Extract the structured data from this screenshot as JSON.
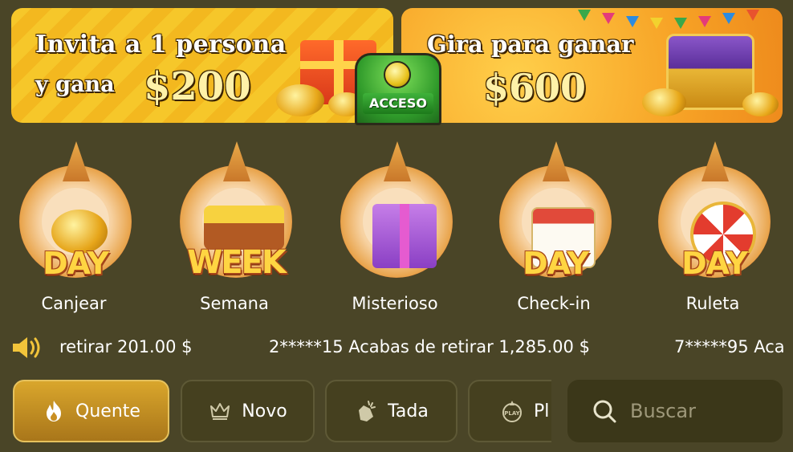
{
  "banners": {
    "invite": {
      "line1": "Invita a 1 persona",
      "line2": "y gana",
      "amount": "$200"
    },
    "spin": {
      "line1": "Gira para ganar",
      "amount": "$600"
    }
  },
  "badge": {
    "label": "ACCESO"
  },
  "activities": [
    {
      "label": "Canjear",
      "word": "DAY",
      "icon": "piggy-bank-icon"
    },
    {
      "label": "Semana",
      "word": "WEEK",
      "icon": "treasure-cart-icon"
    },
    {
      "label": "Misterioso",
      "word": "",
      "icon": "mystery-gift-icon"
    },
    {
      "label": "Check-in",
      "word": "DAY",
      "icon": "calendar-icon"
    },
    {
      "label": "Ruleta",
      "word": "DAY",
      "icon": "roulette-wheel-icon"
    }
  ],
  "marquee": {
    "items": [
      "retirar 201.00 $",
      "2*****15 Acabas de retirar 1,285.00 $",
      "7*****95 Aca"
    ]
  },
  "tabs": [
    {
      "label": "Quente",
      "icon": "flame-icon",
      "active": true
    },
    {
      "label": "Novo",
      "icon": "crown-icon",
      "active": false
    },
    {
      "label": "Tada",
      "icon": "tada-icon",
      "active": false
    },
    {
      "label": "Pl",
      "icon": "play-icon",
      "active": false
    }
  ],
  "search": {
    "placeholder": "Buscar"
  },
  "colors": {
    "background": "#4a4527",
    "active_tab": "#d9a62c",
    "text": "#ffffff"
  }
}
